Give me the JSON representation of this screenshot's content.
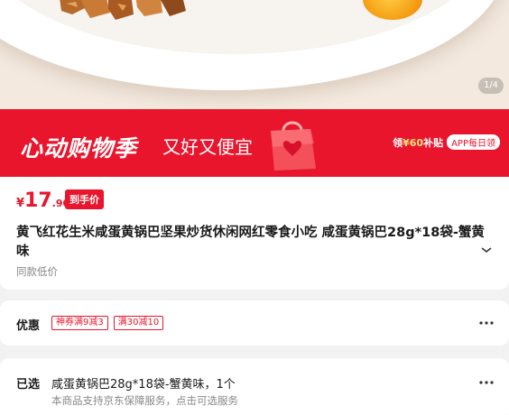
{
  "gallery": {
    "indicator": "1/4"
  },
  "banner": {
    "title": "心动购物季",
    "subtitle": "又好又便宜",
    "bonus_prefix": "领",
    "bonus_amount": "¥60",
    "bonus_suffix": "补贴",
    "app_tag": "APP每日领",
    "bg_color": "#e8152d"
  },
  "price": {
    "currency": "¥",
    "integer": "17",
    "decimal": ".90",
    "tag": "到手价"
  },
  "product": {
    "title": "黄飞红花生米咸蛋黄锅巴坚果炒货休闲网红零食小吃 咸蛋黄锅巴28g*18袋-蟹黄味",
    "same_low": "同款低价"
  },
  "offers": {
    "label": "优惠",
    "coupons": [
      "神券满9减3",
      "满30减10"
    ]
  },
  "selected": {
    "label": "已选",
    "value": "咸蛋黄锅巴28g*18袋-蟹黄味，1个",
    "note": "本商品支持京东保障服务，点击可选服务"
  }
}
